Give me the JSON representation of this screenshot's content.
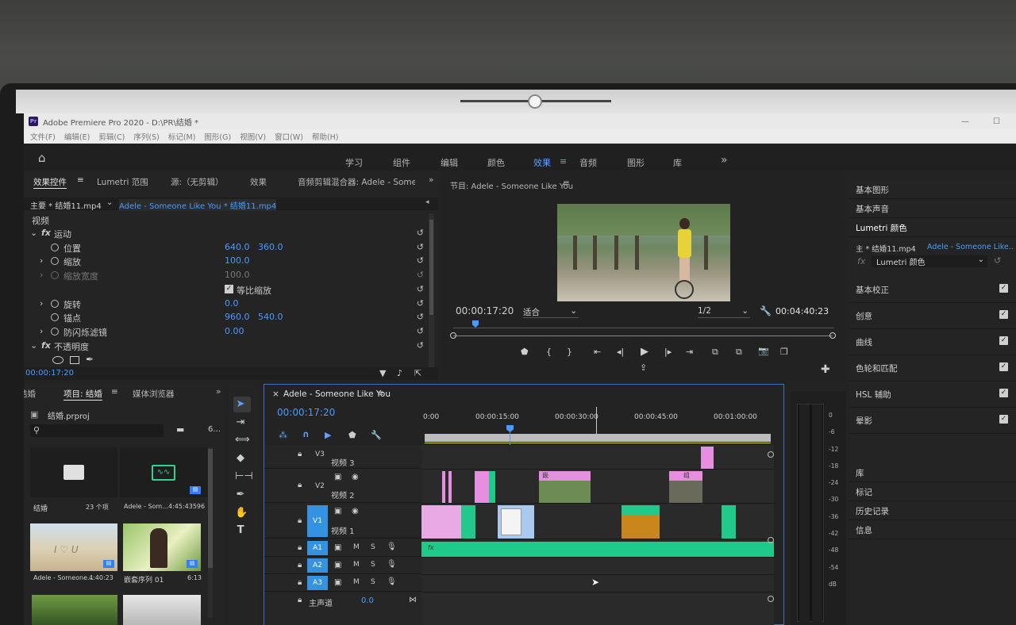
{
  "app": {
    "title": "Adobe Premiere Pro 2020 - D:\\PR\\结婚 *",
    "menu": [
      "文件(F)",
      "编辑(E)",
      "剪辑(C)",
      "序列(S)",
      "标记(M)",
      "图形(G)",
      "视图(V)",
      "窗口(W)",
      "帮助(H)"
    ]
  },
  "workspaces": [
    "学习",
    "组件",
    "编辑",
    "颜色",
    "效果",
    "音频",
    "图形",
    "库"
  ],
  "workspace_active": "效果",
  "effect_controls": {
    "tabs": [
      "效果控件",
      "Lumetri 范围",
      "源:（无剪辑）",
      "效果",
      "音频剪辑混合器: Adele - Someor"
    ],
    "master_clip": "主要 * 结婚11.mp4",
    "sequence_clip": "Adele - Someone Like You * 结婚11.mp4",
    "section": "视频",
    "motion": "运动",
    "position_label": "位置",
    "position_x": "640.0",
    "position_y": "360.0",
    "scale_label": "缩放",
    "scale": "100.0",
    "scale_width_label": "缩放宽度",
    "scale_width": "100.0",
    "uniform_scale_label": "等比缩放",
    "rotation_label": "旋转",
    "rotation": "0.0",
    "anchor_label": "锚点",
    "anchor_x": "960.0",
    "anchor_y": "540.0",
    "anti_flicker_label": "防闪烁滤镜",
    "anti_flicker": "0.00",
    "opacity": "不透明度",
    "timecode": "00:00:17:20"
  },
  "program_monitor": {
    "title": "节目: Adele - Someone Like You",
    "timecode": "00:00:17:20",
    "fit": "适合",
    "resolution": "1/2",
    "duration": "00:04:40:23"
  },
  "right_panel": {
    "top_items": [
      "基本图形",
      "基本声音",
      "Lumetri 颜色"
    ],
    "master": "主 * 结婚11.mp4",
    "sequence": "Adele - Someone Like...",
    "fx": "Lumetri 颜色",
    "sections": [
      "基本校正",
      "创意",
      "曲线",
      "色轮和匹配",
      "HSL 辅助",
      "晕影"
    ],
    "bottom_items": [
      "库",
      "标记",
      "历史记录",
      "信息"
    ]
  },
  "project": {
    "tabs": [
      "结婚",
      "项目: 结婚",
      "媒体浏览器"
    ],
    "file": "结婚.prproj",
    "count_label": "6...",
    "items": [
      {
        "name": "结婚",
        "meta": "23 个项"
      },
      {
        "name": "Adele - Som...",
        "meta": "4:45:43596"
      },
      {
        "name": "Adele - Someone...",
        "meta": "4:40:23"
      },
      {
        "name": "嵌套序列 01",
        "meta": "6:13"
      }
    ]
  },
  "timeline": {
    "title": "Adele - Someone Like You",
    "timecode": "00:00:17:20",
    "ruler": [
      "0:00",
      "00:00:15:00",
      "00:00:30:00",
      "00:00:45:00",
      "00:01:00:00"
    ],
    "tracks": [
      {
        "id": "V3",
        "name": "视频 3"
      },
      {
        "id": "V2",
        "name": "视频 2"
      },
      {
        "id": "V1",
        "name": "视频 1"
      },
      {
        "id": "A1",
        "name": ""
      },
      {
        "id": "A2",
        "name": ""
      },
      {
        "id": "A3",
        "name": ""
      }
    ],
    "master_label": "主声道",
    "master_value": "0.0",
    "meter": [
      "0",
      "-6",
      "-12",
      "-18",
      "-24",
      "-30",
      "-36",
      "-42",
      "-48",
      "-54",
      "dB"
    ],
    "clip_labels": [
      "嵌",
      "组",
      "fx"
    ]
  },
  "colors": {
    "accent": "#4a9bff",
    "v_clip": "#e68fe0",
    "a_clip": "#22c98a"
  }
}
